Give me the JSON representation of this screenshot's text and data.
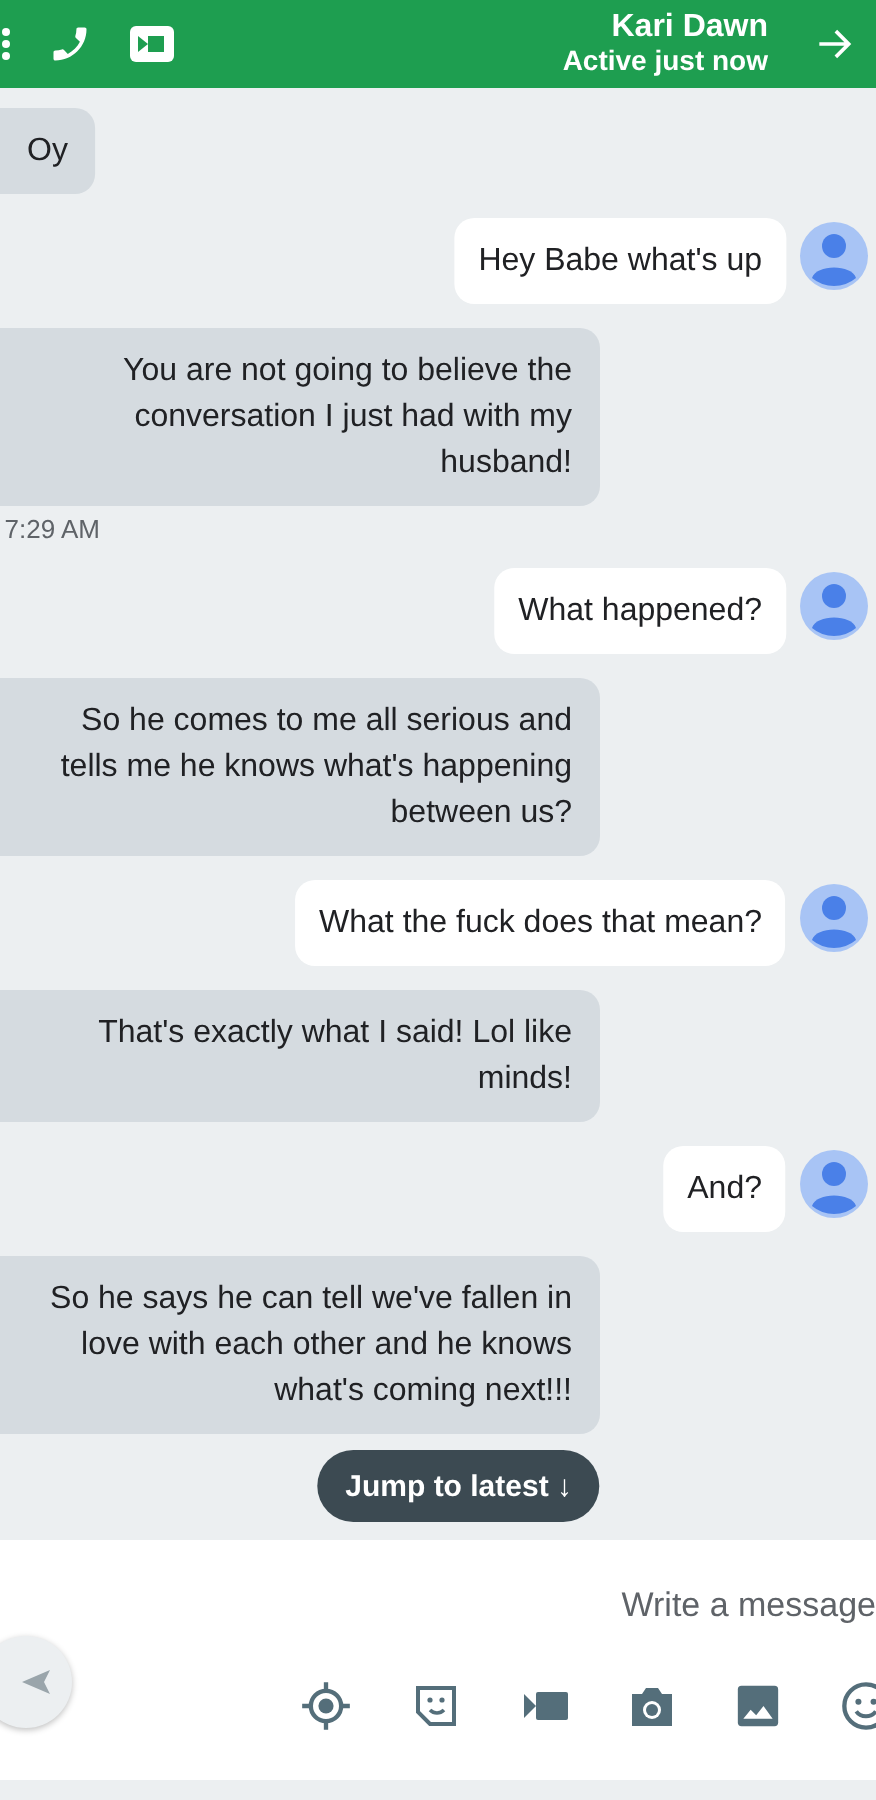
{
  "header": {
    "title": "Kari Dawn",
    "status": "Active just now"
  },
  "messages": [
    {
      "kind": "sent",
      "text": "Oy"
    },
    {
      "kind": "received",
      "text": "Hey Babe what's up"
    },
    {
      "kind": "sent",
      "text": "You are not going to believe the conversation I just had with my husband!",
      "time": "7:29 AM"
    },
    {
      "kind": "received",
      "text": "What happened?"
    },
    {
      "kind": "sent",
      "text": "So he comes to me all serious and tells me he knows what's happening between us?"
    },
    {
      "kind": "received",
      "text": "What the fuck does that mean?"
    },
    {
      "kind": "sent",
      "text": "That's exactly what I said!  Lol like minds!"
    },
    {
      "kind": "received",
      "text": "And?"
    },
    {
      "kind": "sent",
      "text": "So he says he can tell we've fallen in love with each other and he knows what's coming next!!!"
    }
  ],
  "jump": {
    "label": "Jump to latest",
    "arrow": "↓"
  },
  "composer": {
    "placeholder": "Write a message"
  }
}
